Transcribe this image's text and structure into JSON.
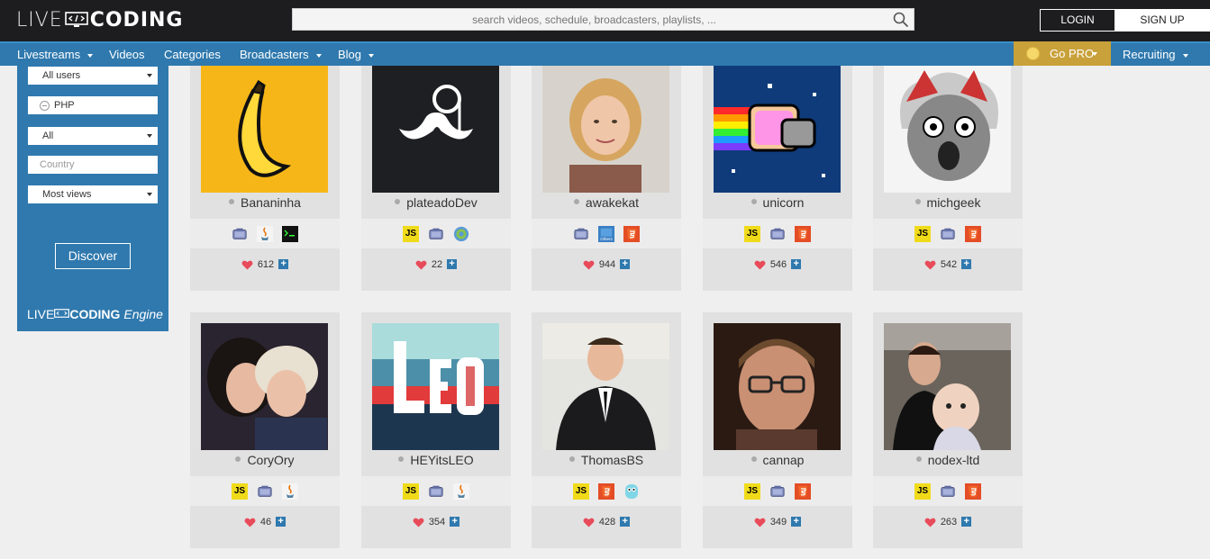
{
  "header": {
    "logo_left": "LIVE",
    "logo_right": "CODING",
    "search_placeholder": "search videos, schedule, broadcasters, playlists, ...",
    "login": "LOGIN",
    "signup": "SIGN UP"
  },
  "nav": {
    "items": [
      "Livestreams",
      "Videos",
      "Categories",
      "Broadcasters",
      "Blog"
    ],
    "go_pro": "Go PRO",
    "recruiting": "Recruiting"
  },
  "sidebar": {
    "filter_users": "All users",
    "filter_language": "PHP",
    "filter_all": "All",
    "country_placeholder": "Country",
    "sort": "Most views",
    "discover": "Discover",
    "engine_left": "LIVE",
    "engine_right": "CODING",
    "engine_suffix": "Engine"
  },
  "colors": {
    "accent": "#2f79ae",
    "gold": "#c9a13a",
    "dark": "#1d1d1f",
    "heart": "#e84b5a"
  },
  "broadcasters": [
    {
      "name": "Bananinha",
      "likes": "612",
      "langs": [
        "php",
        "java",
        "terminal"
      ],
      "avatar": "banana"
    },
    {
      "name": "plateadoDev",
      "likes": "22",
      "langs": [
        "js",
        "php",
        "web"
      ],
      "avatar": "mustache"
    },
    {
      "name": "awakekat",
      "likes": "944",
      "langs": [
        "php",
        "others",
        "html5"
      ],
      "avatar": "person-blonde"
    },
    {
      "name": "unicorn",
      "likes": "546",
      "langs": [
        "js",
        "php",
        "html5"
      ],
      "avatar": "nyan-cat"
    },
    {
      "name": "michgeek",
      "likes": "542",
      "langs": [
        "js",
        "php",
        "html5"
      ],
      "avatar": "cat-hood"
    },
    {
      "name": "CoryOry",
      "likes": "46",
      "langs": [
        "js",
        "php",
        "java"
      ],
      "avatar": "couple"
    },
    {
      "name": "HEYitsLEO",
      "likes": "354",
      "langs": [
        "js",
        "php",
        "java"
      ],
      "avatar": "leo"
    },
    {
      "name": "ThomasBS",
      "likes": "428",
      "langs": [
        "js",
        "html5",
        "go"
      ],
      "avatar": "suit"
    },
    {
      "name": "cannap",
      "likes": "349",
      "langs": [
        "js",
        "php",
        "html5"
      ],
      "avatar": "glasses"
    },
    {
      "name": "nodex-ltd",
      "likes": "263",
      "langs": [
        "js",
        "php",
        "html5"
      ],
      "avatar": "baby"
    }
  ]
}
